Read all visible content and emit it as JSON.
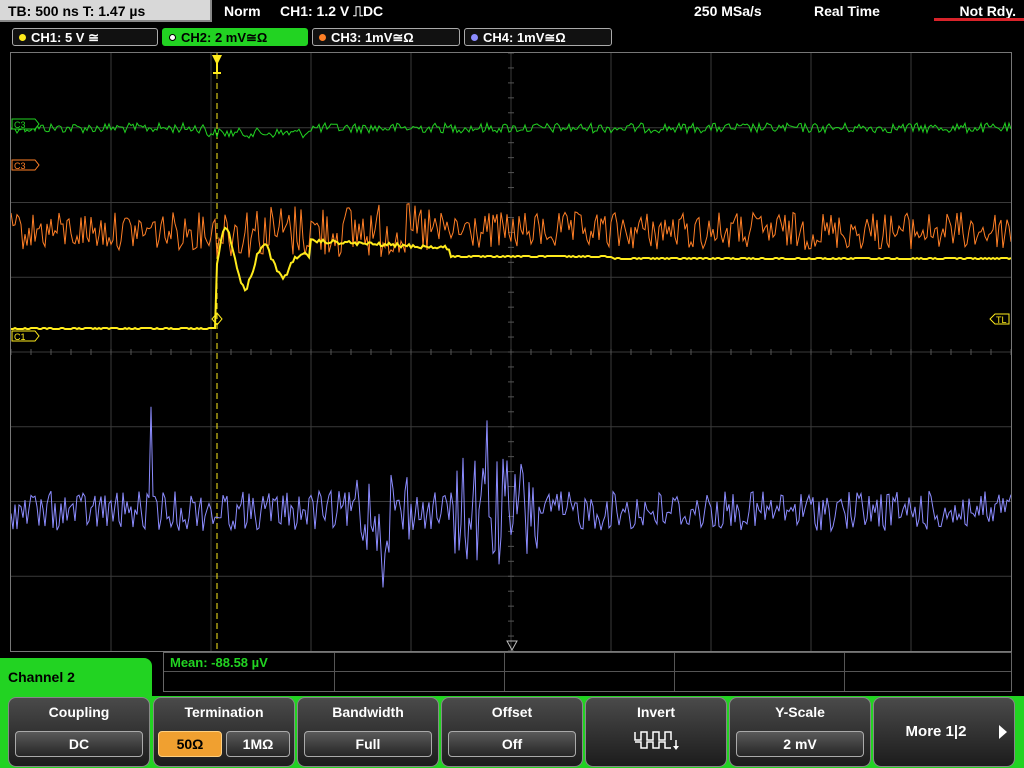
{
  "top": {
    "timebase": "TB: 500 ns  T: 1.47 µs",
    "mode": "Norm",
    "trigger": "CH1: 1.2 V  ⎍DC",
    "sample_rate": "250 MSa/s",
    "acq": "Real Time",
    "status": "Not Rdy."
  },
  "channels": [
    {
      "label": "CH1: 5 V ≅",
      "color": "#ffeb1c"
    },
    {
      "label": "CH2: 2 mV≅Ω",
      "color": "#22d322"
    },
    {
      "label": "CH3: 1mV≅Ω",
      "color": "#ff7f26"
    },
    {
      "label": "CH4: 1mV≅Ω",
      "color": "#8c8cff"
    }
  ],
  "markers": {
    "c3": "C3",
    "c3b": "C3",
    "c1": "C1",
    "tl": "TL"
  },
  "bottom": {
    "menu_title": "Channel 2",
    "measurement": "Mean: -88.58 µV"
  },
  "softkeys": {
    "coupling": {
      "label": "Coupling",
      "value": "DC"
    },
    "termination": {
      "label": "Termination",
      "opt1": "50Ω",
      "opt2": "1MΩ"
    },
    "bandwidth": {
      "label": "Bandwidth",
      "value": "Full"
    },
    "offset": {
      "label": "Offset",
      "value": "Off"
    },
    "invert": {
      "label": "Invert"
    },
    "yscale": {
      "label": "Y-Scale",
      "value": "2 mV"
    },
    "more": {
      "label": "More 1|2"
    }
  }
}
